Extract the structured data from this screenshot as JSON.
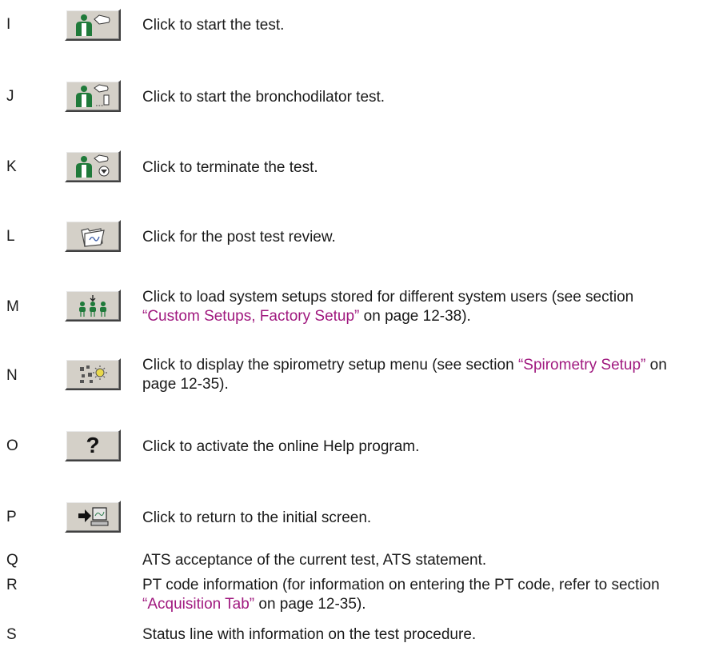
{
  "rows": [
    {
      "letter": "I",
      "icon": "person-lung-icon",
      "text": "Click to start the test."
    },
    {
      "letter": "J",
      "icon": "person-lung-inhaler-icon",
      "text": "Click to start the bronchodilator test."
    },
    {
      "letter": "K",
      "icon": "person-lung-stop-icon",
      "text": "Click to terminate the test."
    },
    {
      "letter": "L",
      "icon": "folder-review-icon",
      "text": "Click for the post test review."
    },
    {
      "letter": "M",
      "icon": "users-setup-icon",
      "text_pre": "Click to load system setups stored for different system users (see section ",
      "link": "“Custom Setups, Factory Setup”",
      "text_post": " on page 12-38)."
    },
    {
      "letter": "N",
      "icon": "setup-menu-icon",
      "text_pre": "Click to display the spirometry setup menu (see section ",
      "link": "“Spirometry Setup”",
      "text_post": " on page 12-35)."
    },
    {
      "letter": "O",
      "icon": "help-icon",
      "glyph": "?",
      "text": "Click to activate the online Help program."
    },
    {
      "letter": "P",
      "icon": "return-screen-icon",
      "text": "Click to return to the initial screen."
    },
    {
      "letter": "Q",
      "text": "ATS acceptance of the current test, ATS statement."
    },
    {
      "letter": "R",
      "text_pre": "PT code information (for information on entering the PT code, refer to section ",
      "link": "“Acquisition Tab”",
      "text_post": " on page 12-35)."
    },
    {
      "letter": "S",
      "text": "Status line with information on the test procedure."
    }
  ],
  "colors": {
    "link": "#a0197f",
    "icon_green": "#1f7a3a",
    "button_face": "#d4d0c8"
  }
}
